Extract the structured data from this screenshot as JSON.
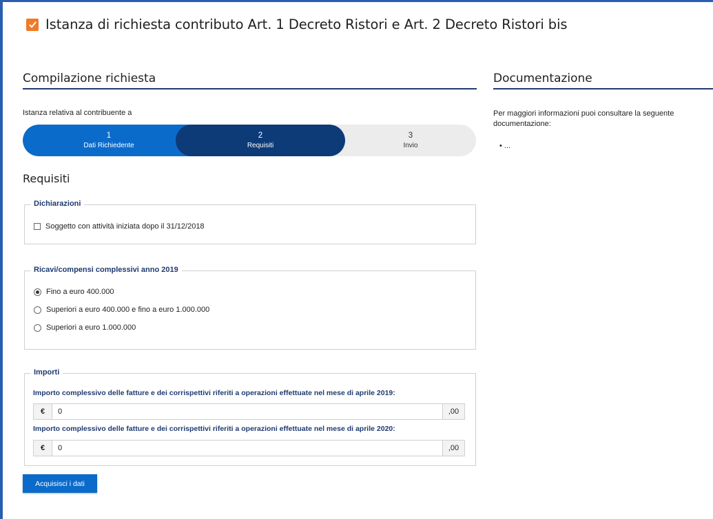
{
  "page": {
    "title": "Istanza di richiesta contributo Art. 1 Decreto Ristori e Art. 2 Decreto Ristori bis",
    "accent_color": "#f07a25"
  },
  "compilazione": {
    "heading": "Compilazione richiesta",
    "contributor_text": "Istanza relativa al contribuente a",
    "steps": [
      {
        "number": "1",
        "label": "Dati Richiedente",
        "state": "completed"
      },
      {
        "number": "2",
        "label": "Requisiti",
        "state": "active"
      },
      {
        "number": "3",
        "label": "Invio",
        "state": "pending"
      }
    ],
    "step_colors": {
      "completed": "#0b6bcb",
      "active": "#0d3b78",
      "pending": "#ececec"
    }
  },
  "requisiti": {
    "heading": "Requisiti",
    "dichiarazioni": {
      "legend": "Dichiarazioni",
      "checkbox_label": "Soggetto con attività iniziata dopo il 31/12/2018",
      "checked": false
    },
    "ricavi": {
      "legend": "Ricavi/compensi complessivi anno 2019",
      "options": [
        {
          "label": "Fino a euro 400.000",
          "selected": true
        },
        {
          "label": "Superiori a euro 400.000 e fino a euro 1.000.000",
          "selected": false
        },
        {
          "label": "Superiori a euro 1.000.000",
          "selected": false
        }
      ]
    },
    "importi": {
      "legend": "Importi",
      "fields": [
        {
          "label": "Importo complessivo delle fatture e dei corrispettivi riferiti a operazioni effettuate nel mese di aprile 2019:",
          "currency": "€",
          "value": "0",
          "decimals": ",00"
        },
        {
          "label": "Importo complessivo delle fatture e dei corrispettivi riferiti a operazioni effettuate nel mese di aprile 2020:",
          "currency": "€",
          "value": "0",
          "decimals": ",00"
        }
      ]
    },
    "submit_label": "Acquisisci i dati"
  },
  "documentazione": {
    "heading": "Documentazione",
    "text": "Per maggiori informazioni puoi consultare la seguente documentazione:",
    "items": [
      "..."
    ]
  }
}
